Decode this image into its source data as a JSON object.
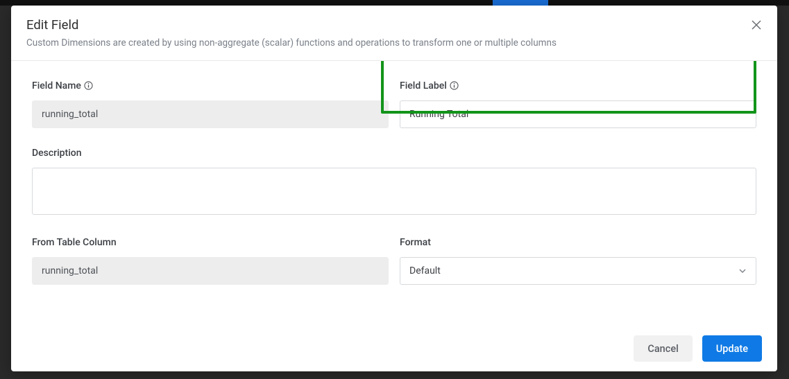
{
  "header": {
    "title": "Edit Field",
    "subtitle": "Custom Dimensions are created by using non-aggregate (scalar) functions and operations to transform one or multiple columns"
  },
  "form": {
    "field_name": {
      "label": "Field Name",
      "value": "running_total"
    },
    "field_label": {
      "label": "Field Label",
      "value": "Running Total"
    },
    "description": {
      "label": "Description",
      "value": ""
    },
    "from_table_column": {
      "label": "From Table Column",
      "value": "running_total"
    },
    "format": {
      "label": "Format",
      "selected": "Default"
    }
  },
  "footer": {
    "cancel": "Cancel",
    "update": "Update"
  }
}
